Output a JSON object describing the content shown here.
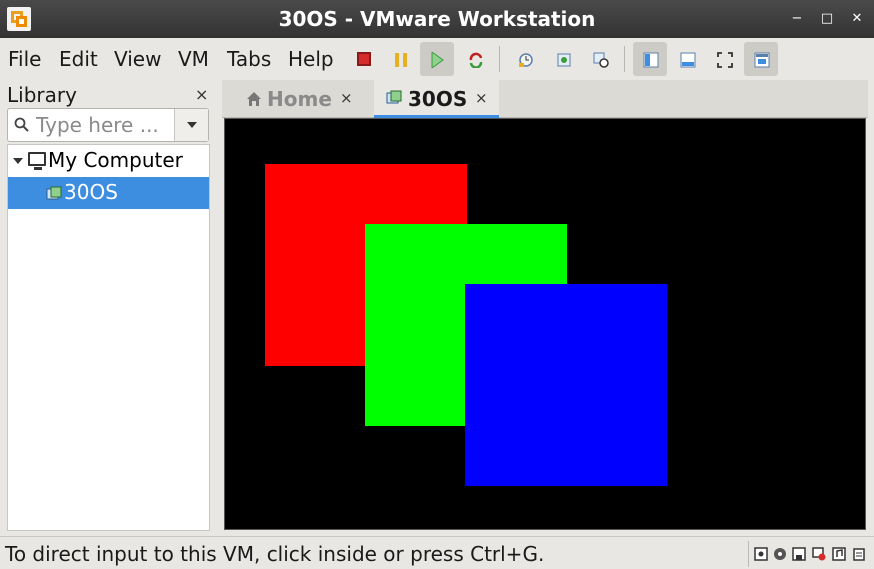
{
  "window": {
    "title": "30OS - VMware Workstation",
    "minimize_glyph": "−",
    "maximize_glyph": "□",
    "close_glyph": "✕"
  },
  "menu": {
    "items": [
      "File",
      "Edit",
      "View",
      "VM",
      "Tabs",
      "Help"
    ]
  },
  "toolbar": {
    "icons": [
      "power-off-icon",
      "suspend-icon",
      "play-icon",
      "reset-icon",
      "snapshot-icon",
      "revert-snapshot-icon",
      "snapshot-manager-icon",
      "show-library-icon",
      "thumbnail-bar-icon",
      "fullscreen-icon",
      "unity-icon"
    ],
    "colors": {
      "power_off": "#d62b2b",
      "suspend": "#e8b020",
      "play": "#3a9c3a",
      "reset": "#c02020"
    }
  },
  "library": {
    "title": "Library",
    "close_glyph": "×",
    "search_placeholder": "Type here ...",
    "tree": {
      "root_label": "My Computer",
      "children": [
        {
          "label": "30OS",
          "selected": true
        }
      ]
    }
  },
  "tabs": [
    {
      "label": "Home",
      "icon": "home-icon",
      "active": false,
      "close_glyph": "×"
    },
    {
      "label": "30OS",
      "icon": "vm-icon",
      "active": true,
      "close_glyph": "×"
    }
  ],
  "vm_display": {
    "background": "#000000",
    "squares": [
      {
        "name": "red-square",
        "color": "#ff0000"
      },
      {
        "name": "green-square",
        "color": "#00ff00"
      },
      {
        "name": "blue-square",
        "color": "#0000ff"
      }
    ]
  },
  "status": {
    "text": "To direct input to this VM, click inside or press Ctrl+G.",
    "device_icons": [
      "hard-disk-icon",
      "cd-dvd-icon",
      "floppy-icon",
      "network-icon",
      "sound-icon",
      "message-log-icon"
    ]
  },
  "colors": {
    "accent": "#3d8ee0",
    "titlebar": "#3a3a3a",
    "selection": "#3d8ee0"
  }
}
